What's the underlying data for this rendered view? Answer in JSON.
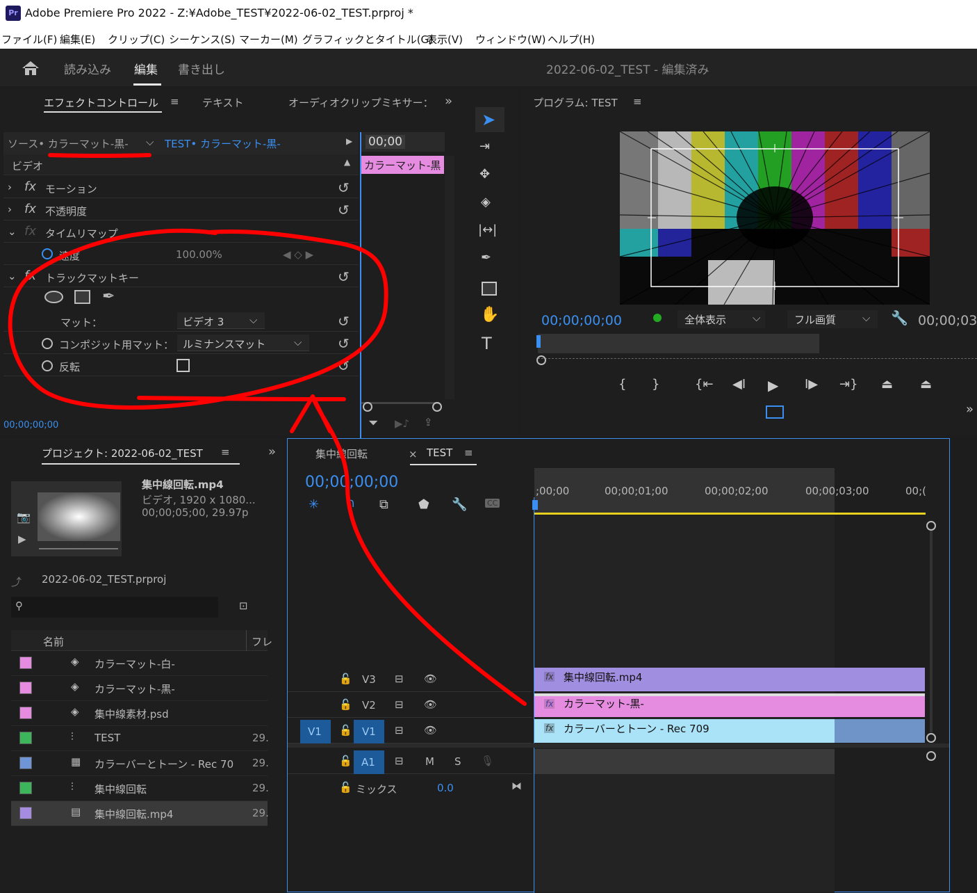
{
  "app": {
    "title": "Adobe Premiere Pro 2022 - Z:¥Adobe_TEST¥2022-06-02_TEST.prproj *",
    "logo": "Pr"
  },
  "menu": [
    "ファイル(F)",
    "編集(E)",
    "クリップ(C)",
    "シーケンス(S)",
    "マーカー(M)",
    "グラフィックとタイトル(G)",
    "表示(V)",
    "ウィンドウ(W)",
    "ヘルプ(H)"
  ],
  "workspace": {
    "tabs": [
      "読み込み",
      "編集",
      "書き出し"
    ],
    "active": "編集",
    "project_status": "2022-06-02_TEST - 編集済み"
  },
  "effect_controls": {
    "tabs": [
      "エフェクトコントロール",
      "テキスト",
      "オーディオクリップミキサー："
    ],
    "source_label": "ソース• カラーマット-黒-",
    "seq_label": "TEST• カラーマット-黒-",
    "timecode_mini": "00;00",
    "clip_label": "カラーマット-黒",
    "section_video": "ビデオ",
    "motion": "モーション",
    "opacity": "不透明度",
    "time_remap": "タイムリマップ",
    "speed_label": "速度",
    "speed_value": "100.00%",
    "track_matte": "トラックマットキー",
    "matte_label": "マット：",
    "matte_value": "ビデオ 3",
    "composite_label": "コンポジット用マット：",
    "composite_value": "ルミナンスマット",
    "invert_label": "反転",
    "footer_tc": "00;00;00;00"
  },
  "program": {
    "title": "プログラム: TEST",
    "timecode": "00;00;00;00",
    "fit": "全体表示",
    "quality": "フル画質",
    "duration": "00;00;03"
  },
  "project": {
    "title": "プロジェクト: 2022-06-02_TEST",
    "preview_name": "集中線回転.mp4",
    "preview_info1": "ビデオ, 1920 x 1080...",
    "preview_info2": "00;00;05;00, 29.97p",
    "file": "2022-06-02_TEST.prproj",
    "col_name": "名前",
    "col_fps": "フレ",
    "items": [
      {
        "name": "カラーマット-白-",
        "fps": "",
        "color": "#e58be0",
        "icon": "matte-icon"
      },
      {
        "name": "カラーマット-黒-",
        "fps": "",
        "color": "#e58be0",
        "icon": "matte-icon"
      },
      {
        "name": "集中線素材.psd",
        "fps": "",
        "color": "#e58be0",
        "icon": "matte-icon"
      },
      {
        "name": "TEST",
        "fps": "29.",
        "color": "#3db55a",
        "icon": "sequence-icon"
      },
      {
        "name": "カラーバーとトーン - Rec 70",
        "fps": "29.",
        "color": "#6f95d6",
        "icon": "bars-icon"
      },
      {
        "name": "集中線回転",
        "fps": "29.",
        "color": "#3db55a",
        "icon": "sequence-icon"
      },
      {
        "name": "集中線回転.mp4",
        "fps": "29.",
        "color": "#a68ce0",
        "icon": "film-icon"
      }
    ]
  },
  "timeline": {
    "tabs": [
      "集中線回転",
      "TEST"
    ],
    "timecode": "00;00;00;00",
    "ruler": [
      ";00;00",
      "00;00;01;00",
      "00;00;02;00",
      "00;00;03;00",
      "00;("
    ],
    "tracks": {
      "v3": "V3",
      "v2": "V2",
      "v1": "V1",
      "v1_src": "V1",
      "a1": "A1",
      "m": "M",
      "s": "S",
      "mix": "ミックス",
      "mix_value": "0.0"
    },
    "clips": {
      "v3": "集中線回転.mp4",
      "v2": "カラーマット-黒-",
      "v1": "カラーバーとトーン - Rec 709"
    },
    "fx": "fx"
  }
}
